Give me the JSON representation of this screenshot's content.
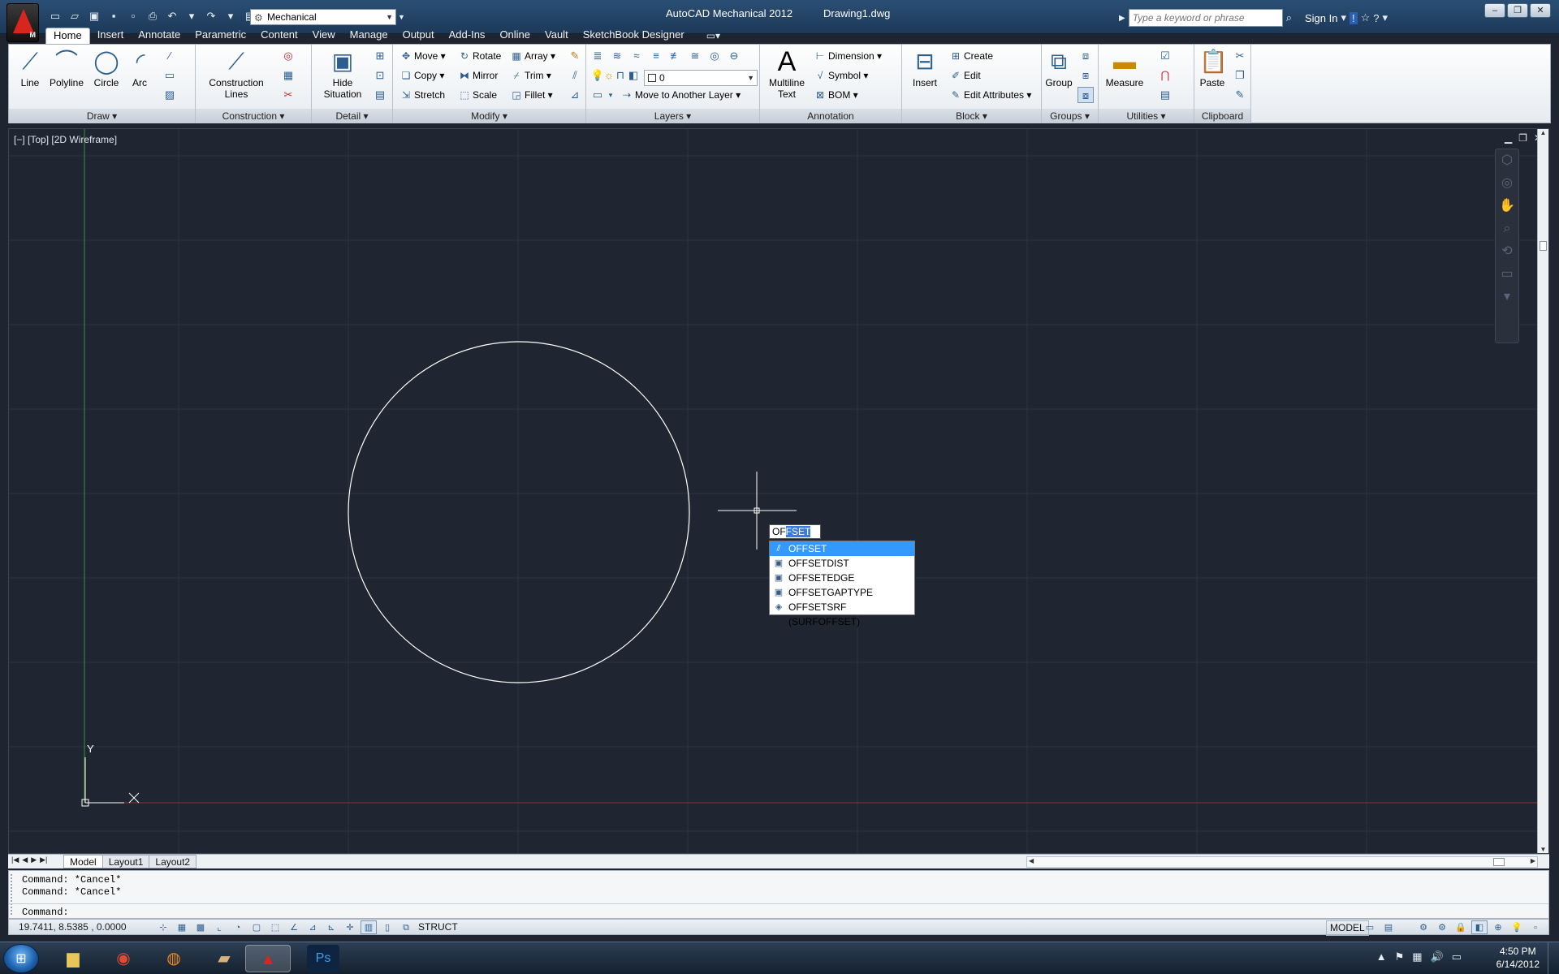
{
  "titlebar": {
    "app_title": "AutoCAD Mechanical 2012",
    "doc_title": "Drawing1.dwg",
    "workspace": "Mechanical",
    "search_placeholder": "Type a keyword or phrase",
    "sign_in": "Sign In",
    "app_badge": "M"
  },
  "ribbon_tabs": [
    "Home",
    "Insert",
    "Annotate",
    "Parametric",
    "Content",
    "View",
    "Manage",
    "Output",
    "Add-Ins",
    "Online",
    "Vault",
    "SketchBook Designer"
  ],
  "ribbon": {
    "draw": {
      "title": "Draw",
      "line": "Line",
      "polyline": "Polyline",
      "circle": "Circle",
      "arc": "Arc"
    },
    "construction": {
      "title": "Construction",
      "lines1": "Construction",
      "lines2": "Lines"
    },
    "detail": {
      "title": "Detail",
      "hide1": "Hide",
      "hide2": "Situation"
    },
    "modify": {
      "title": "Modify",
      "move": "Move",
      "rotate": "Rotate",
      "array": "Array",
      "copy": "Copy",
      "mirror": "Mirror",
      "trim": "Trim",
      "stretch": "Stretch",
      "scale": "Scale",
      "fillet": "Fillet"
    },
    "layers": {
      "title": "Layers",
      "current_layer": "0",
      "move_to_layer": "Move to Another Layer"
    },
    "annotation": {
      "title": "Annotation",
      "mtext1": "Multiline",
      "mtext2": "Text",
      "dimension": "Dimension",
      "symbol": "Symbol",
      "bom": "BOM"
    },
    "block": {
      "title": "Block",
      "insert": "Insert",
      "create": "Create",
      "edit": "Edit",
      "edit_attributes": "Edit Attributes"
    },
    "groups": {
      "title": "Groups",
      "group": "Group"
    },
    "utilities": {
      "title": "Utilities",
      "measure": "Measure"
    },
    "clipboard": {
      "title": "Clipboard",
      "paste": "Paste"
    }
  },
  "viewport": {
    "label": "[−] [Top] [2D Wireframe]"
  },
  "dynamic_input": {
    "typed": "OF",
    "completion": "FSET"
  },
  "autocomplete": [
    {
      "label": "OFFSET",
      "icon": "offset-icon",
      "selected": true
    },
    {
      "label": "OFFSETDIST",
      "icon": "sysvar-icon",
      "selected": false
    },
    {
      "label": "OFFSETEDGE",
      "icon": "sysvar-icon",
      "selected": false
    },
    {
      "label": "OFFSETGAPTYPE",
      "icon": "sysvar-icon",
      "selected": false
    },
    {
      "label": "OFFSETSRF (SURFOFFSET)",
      "icon": "surface-offset-icon",
      "selected": false
    }
  ],
  "ucs": {
    "y_label": "Y",
    "x_label": "X"
  },
  "layout_tabs": [
    "Model",
    "Layout1",
    "Layout2"
  ],
  "command_line": {
    "history": [
      "Command: *Cancel*",
      "Command: *Cancel*"
    ],
    "prompt": "Command:"
  },
  "statusbar": {
    "coords": "19.7411, 8.5385 , 0.0000",
    "struct": "STRUCT",
    "model": "MODEL"
  },
  "clock": {
    "time": "4:50 PM",
    "date": "6/14/2012"
  },
  "colors": {
    "canvas": "#202631",
    "circle": "#ffffff",
    "y_axis": "#3d8f3d",
    "x_axis": "#8f3030",
    "selection": "#3399ff",
    "titlebar": "#2b4f74"
  }
}
